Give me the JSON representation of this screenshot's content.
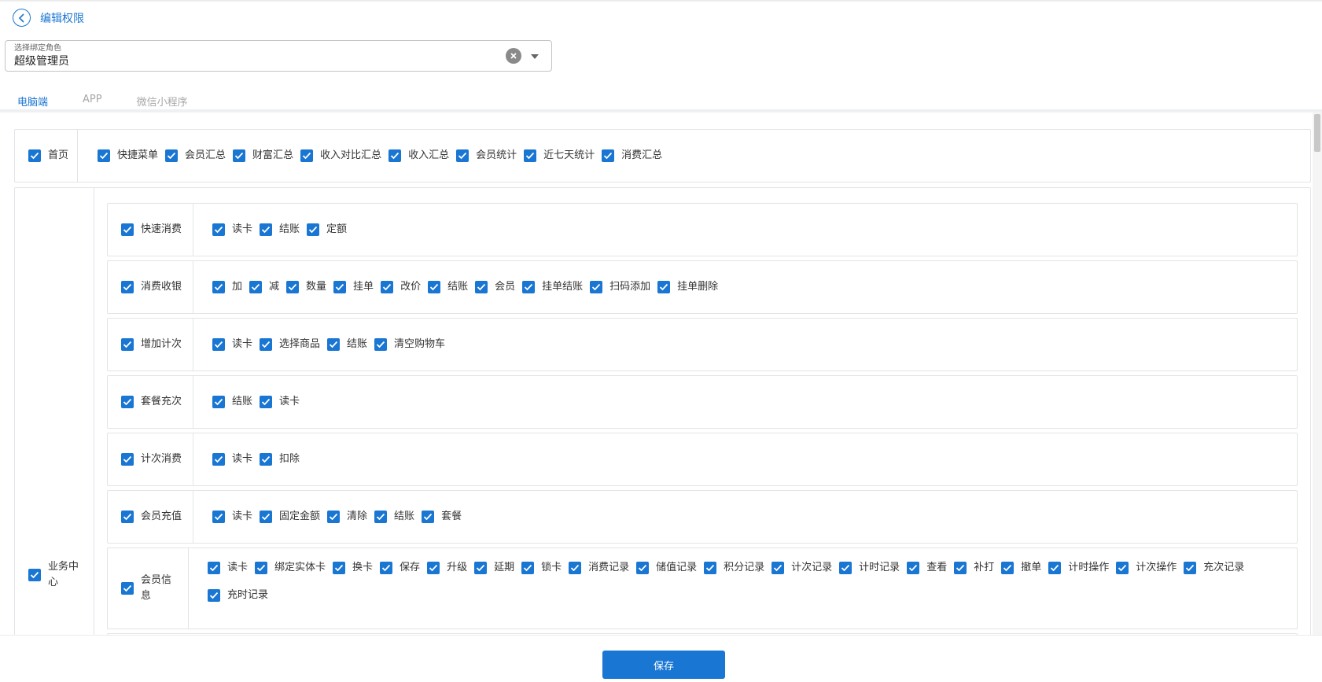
{
  "header": {
    "title": "编辑权限"
  },
  "role_select": {
    "label": "选择绑定角色",
    "value": "超级管理员"
  },
  "tabs": [
    {
      "label": "电脑端",
      "active": true
    },
    {
      "label": "APP",
      "active": false
    },
    {
      "label": "微信小程序",
      "active": false
    }
  ],
  "permissions": {
    "home": {
      "label": "首页",
      "items": [
        "快捷菜单",
        "会员汇总",
        "财富汇总",
        "收入对比汇总",
        "收入汇总",
        "会员统计",
        "近七天统计",
        "消费汇总"
      ]
    },
    "business": {
      "label": "业务中心",
      "modules": [
        {
          "label": "快速消费",
          "items": [
            "读卡",
            "结账",
            "定额"
          ]
        },
        {
          "label": "消费收银",
          "items": [
            "加",
            "减",
            "数量",
            "挂单",
            "改价",
            "结账",
            "会员",
            "挂单结账",
            "扫码添加",
            "挂单删除"
          ]
        },
        {
          "label": "增加计次",
          "items": [
            "读卡",
            "选择商品",
            "结账",
            "清空购物车"
          ]
        },
        {
          "label": "套餐充次",
          "items": [
            "结账",
            "读卡"
          ]
        },
        {
          "label": "计次消费",
          "items": [
            "读卡",
            "扣除"
          ]
        },
        {
          "label": "会员充值",
          "items": [
            "读卡",
            "固定金额",
            "清除",
            "结账",
            "套餐"
          ]
        },
        {
          "label": "会员信息",
          "items": [
            "读卡",
            "绑定实体卡",
            "换卡",
            "保存",
            "升级",
            "延期",
            "锁卡",
            "消费记录",
            "储值记录",
            "积分记录",
            "计次记录",
            "计时记录",
            "查看",
            "补打",
            "撤单",
            "计时操作",
            "计次操作",
            "充次记录",
            "充时记录"
          ]
        }
      ]
    }
  },
  "footer": {
    "save_label": "保存"
  },
  "colors": {
    "accent": "#1976d2",
    "border": "#e2e4e7"
  }
}
